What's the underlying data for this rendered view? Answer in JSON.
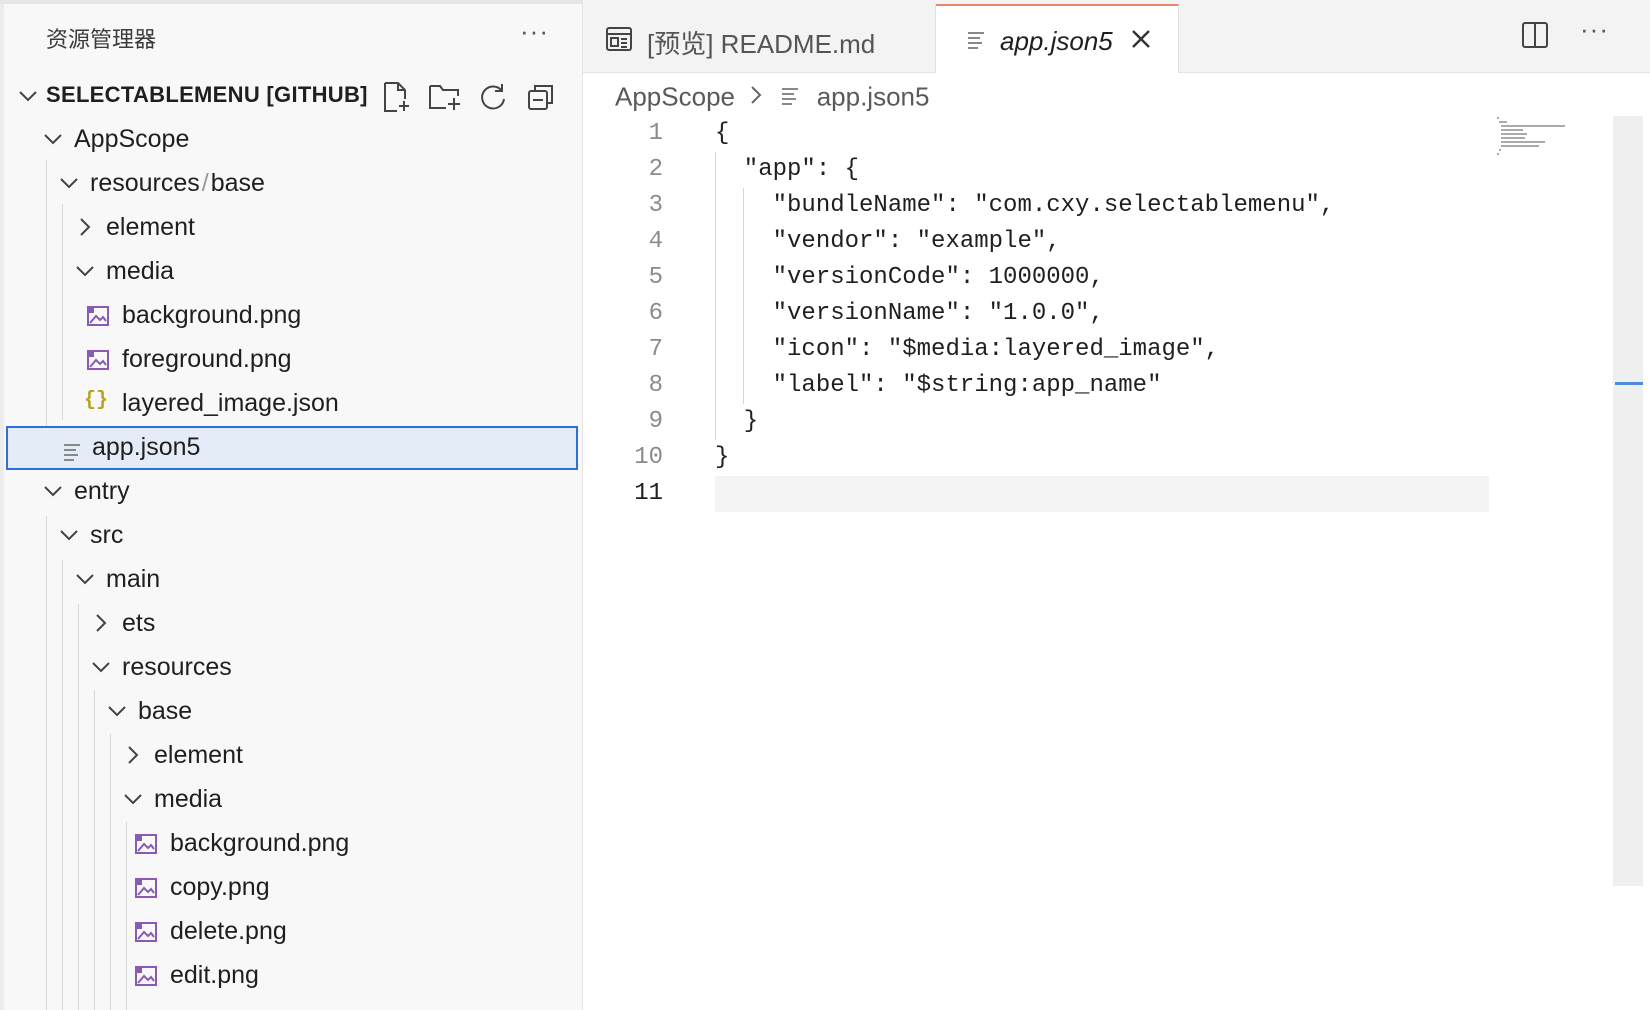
{
  "explorer": {
    "title": "资源管理器",
    "more_label": "···",
    "project_title": "SELECTABLEMENU [GITHUB]",
    "actions": [
      "new-file-icon",
      "new-folder-icon",
      "refresh-icon",
      "collapse-all-icon"
    ]
  },
  "tree": [
    {
      "label": "AppScope",
      "kind": "folder-open"
    },
    {
      "label_a": "resources",
      "label_sep": "/",
      "label_b": "base",
      "kind": "folder-open"
    },
    {
      "label": "element",
      "kind": "folder-closed"
    },
    {
      "label": "media",
      "kind": "folder-open"
    },
    {
      "label": "background.png",
      "kind": "image"
    },
    {
      "label": "foreground.png",
      "kind": "image"
    },
    {
      "label": "layered_image.json",
      "kind": "json"
    },
    {
      "label": "app.json5",
      "kind": "text",
      "selected": true
    },
    {
      "label": "entry",
      "kind": "folder-open"
    },
    {
      "label": "src",
      "kind": "folder-open"
    },
    {
      "label": "main",
      "kind": "folder-open"
    },
    {
      "label": "ets",
      "kind": "folder-closed"
    },
    {
      "label": "resources",
      "kind": "folder-open"
    },
    {
      "label": "base",
      "kind": "folder-open"
    },
    {
      "label": "element",
      "kind": "folder-closed"
    },
    {
      "label": "media",
      "kind": "folder-open"
    },
    {
      "label": "background.png",
      "kind": "image"
    },
    {
      "label": "copy.png",
      "kind": "image"
    },
    {
      "label": "delete.png",
      "kind": "image"
    },
    {
      "label": "edit.png",
      "kind": "image"
    }
  ],
  "tabs": [
    {
      "label": "[预览] README.md",
      "active": false,
      "icon": "preview-icon"
    },
    {
      "label": "app.json5",
      "active": true,
      "icon": "text-file-icon"
    }
  ],
  "editor_actions": {
    "more_label": "···"
  },
  "breadcrumb": {
    "segment1": "AppScope",
    "segment2": "app.json5"
  },
  "code_lines": [
    {
      "n": "1",
      "text": "{"
    },
    {
      "n": "2",
      "text": "  \"app\": {"
    },
    {
      "n": "3",
      "text": "    \"bundleName\": \"com.cxy.selectablemenu\","
    },
    {
      "n": "4",
      "text": "    \"vendor\": \"example\","
    },
    {
      "n": "5",
      "text": "    \"versionCode\": 1000000,"
    },
    {
      "n": "6",
      "text": "    \"versionName\": \"1.0.0\","
    },
    {
      "n": "7",
      "text": "    \"icon\": \"$media:layered_image\","
    },
    {
      "n": "8",
      "text": "    \"label\": \"$string:app_name\""
    },
    {
      "n": "9",
      "text": "  }"
    },
    {
      "n": "10",
      "text": "}"
    },
    {
      "n": "11",
      "text": ""
    }
  ],
  "colors": {
    "accent": "#2f6fd6",
    "tab_top": "#e8866b",
    "image_icon": "#8a5bb5",
    "json_icon": "#b5a51c"
  }
}
